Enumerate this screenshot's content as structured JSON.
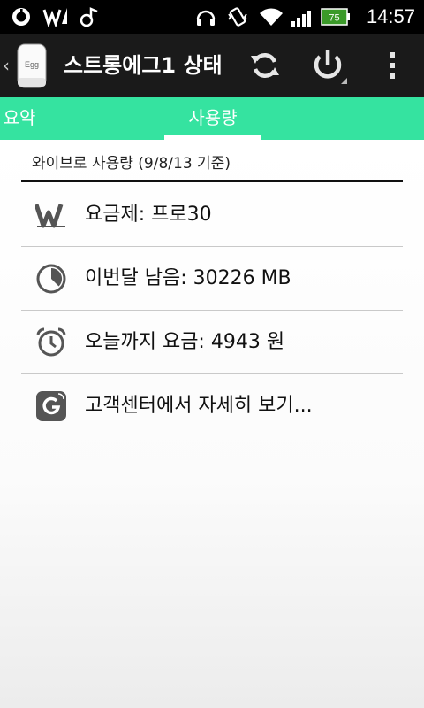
{
  "statusbar": {
    "time": "14:57",
    "battery_level": "75",
    "icons": [
      "beats-audio-icon",
      "signal-w-icon",
      "music-note-icon",
      "headset-icon",
      "vibrate-icon",
      "wifi-icon",
      "cell-signal-icon",
      "battery-icon"
    ]
  },
  "actionbar": {
    "title": "스트롱에그1 상태",
    "app_icon_label": "Egg",
    "buttons": [
      "refresh-icon",
      "power-icon",
      "overflow-menu-icon"
    ]
  },
  "tabs": [
    {
      "label": "요약",
      "selected": false
    },
    {
      "label": "사용량",
      "selected": true
    }
  ],
  "usage": {
    "header": "와이브로 사용량 (9/8/13 기준)",
    "rows": [
      {
        "icon": "wibro-w-icon",
        "label": "요금제: 프로30"
      },
      {
        "icon": "pie-clock-icon",
        "label": "이번달 남음: 30226 MB"
      },
      {
        "icon": "alarm-clock-icon",
        "label": "오늘까지 요금: 4943 원"
      },
      {
        "icon": "support-logo-icon",
        "label": "고객센터에서 자세히 보기..."
      }
    ]
  },
  "colors": {
    "accent": "#35e3a0",
    "actionbar": "#1a1a1a",
    "statusbar": "#000000"
  }
}
